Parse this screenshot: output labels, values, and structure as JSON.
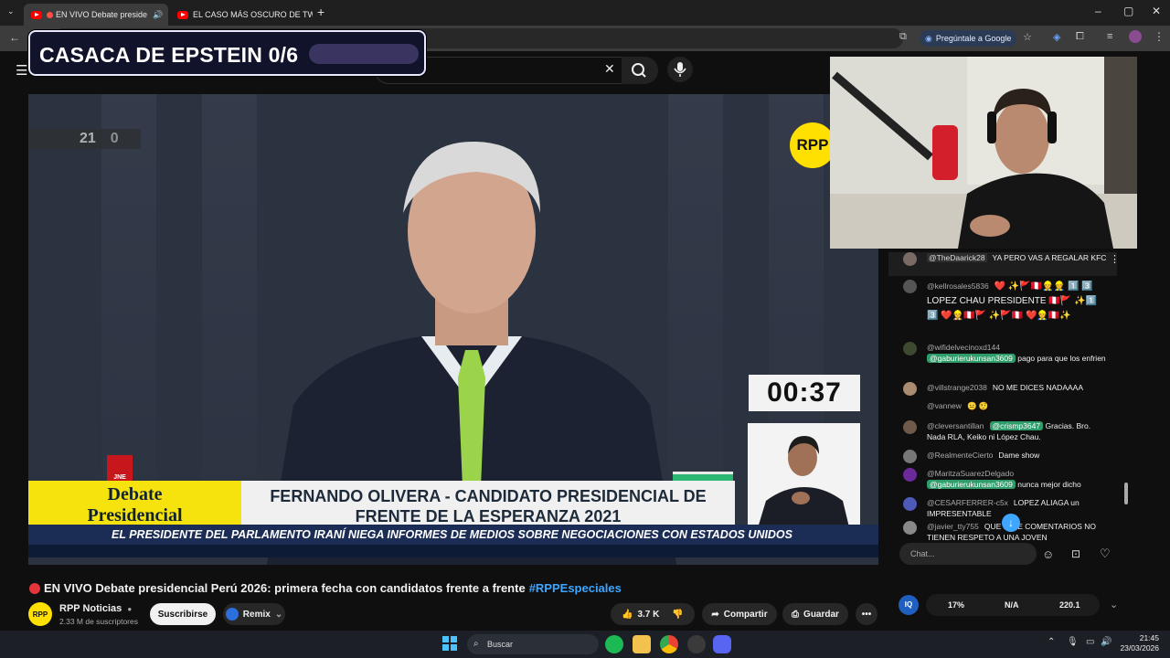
{
  "browser": {
    "tabs": [
      {
        "label": "EN VIVO Debate preside",
        "active": true,
        "audio_icon": "speaker-icon"
      },
      {
        "label": "EL CASO MÁS OSCURO DE TW",
        "active": false
      }
    ],
    "new_tab": "+",
    "ask_google": "Pregúntale a Google",
    "controls": {
      "minimize": "–",
      "maximize": "▢",
      "close": "✕"
    }
  },
  "overlay": {
    "text": "CASACA DE EPSTEIN 0/6"
  },
  "video": {
    "score": "21",
    "score_extra": "0",
    "logo": "RPP",
    "timer": "00:37",
    "jne": "JNE",
    "lower_third_left": [
      "Debate",
      "Presidencial"
    ],
    "lower_third_right": [
      "FERNANDO OLIVERA - CANDIDATO PRESIDENCIAL DE",
      "FRENTE DE LA ESPERANZA 2021"
    ],
    "ticker": "EL PRESIDENTE DEL PARLAMENTO IRANÍ NIEGA INFORMES DE MEDIOS SOBRE NEGOCIACIONES CON ESTADOS UNIDOS"
  },
  "page": {
    "title": "EN VIVO Debate presidencial Perú 2026: primera fecha con candidatos frente a frente",
    "hashtag": "#RPPEspeciales",
    "channel_avatar": "RPP",
    "channel_name": "RPP Noticias",
    "subscribers": "2.33 M de suscriptores",
    "subscribe": "Suscribirse",
    "remix": "Remix",
    "likes": "3.7 K",
    "share": "Compartir",
    "save": "Guardar",
    "more": "•••"
  },
  "chat": {
    "messages": [
      {
        "author": "@TheDaarick28",
        "text": "YA PERO VAS A REGALAR KFC"
      },
      {
        "author": "@kellrosales5836",
        "text": "❤️ ✨🚩🇵🇪👷👷 1️⃣ 3️⃣ LOPEZ CHAU PRESIDENTE 🇵🇪🚩 ✨1️⃣ 3️⃣ ❤️👷🇵🇪🚩 ✨🚩🇵🇪 ❤️👷🇵🇪✨"
      },
      {
        "author": "@wifidelvecinoxd144",
        "mention": "@gaburierukunsan3609",
        "text": "pago para que los enfrien"
      },
      {
        "author": "@villstrange2038",
        "text": "NO ME DICES NADAAAA"
      },
      {
        "author": "@vannew",
        "text": "😐 🤨"
      },
      {
        "author": "@cleversantillan",
        "mention": "@crismp3647",
        "text": "Gracias. Bro. Nada RLA, Keiko ni López Chau."
      },
      {
        "author": "@RealmenteCierto",
        "text": "Dame show"
      },
      {
        "author": "@MaritzaSuarezDelgado",
        "mention": "@gaburierukunsan3609",
        "text": "nunca mejor dicho"
      },
      {
        "author": "@CESARFERRER-c5x",
        "text": "LOPEZ ALIAGA un IMPRESENTABLE"
      },
      {
        "author": "@javier_tty755",
        "text": "QUE ... DE COMENTARIOS NO TIENEN RESPETO A UNA JOVEN"
      }
    ],
    "input_placeholder": "Chat..."
  },
  "stats": {
    "a": "17%",
    "b": "N/A",
    "c": "220.1"
  },
  "taskbar": {
    "search": "Buscar",
    "time": "21:45",
    "date": "23/03/2026"
  },
  "colors": {
    "accent_yellow": "#f6e30e",
    "ticker_blue": "#1b2d55",
    "mention_green": "#2f9d6a"
  }
}
